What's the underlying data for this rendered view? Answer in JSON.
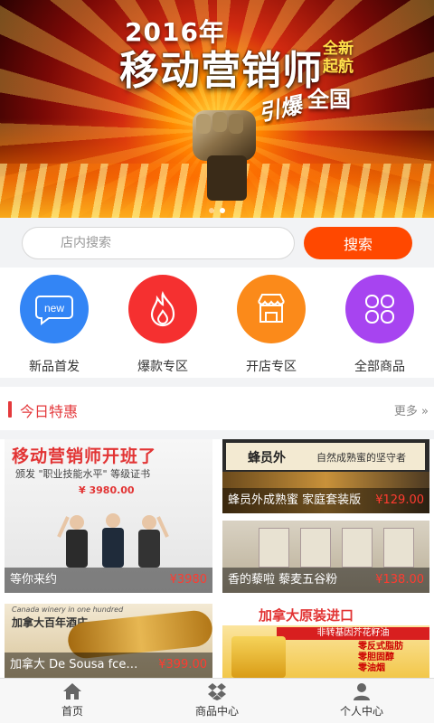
{
  "banner": {
    "year": "2016年",
    "title": "移动营销师",
    "side": "全新起航",
    "brush": "引爆",
    "sub": "全国",
    "dots": 2,
    "active_dot": 1
  },
  "search": {
    "placeholder": "店内搜索",
    "button": "搜索"
  },
  "categories": [
    {
      "label": "新品首发",
      "icon": "new-icon",
      "color": "#3385f5"
    },
    {
      "label": "爆款专区",
      "icon": "fire-icon",
      "color": "#f53030"
    },
    {
      "label": "开店专区",
      "icon": "shop-icon",
      "color": "#fb8a1a"
    },
    {
      "label": "全部商品",
      "icon": "grid-icon",
      "color": "#a744f0"
    }
  ],
  "today": {
    "title": "今日特惠",
    "more": "更多 »"
  },
  "products": [
    {
      "name": "等你来约",
      "price": "¥3980",
      "image_headline": "移动营销师开班了",
      "image_cert": "颁发 \"职业技能水平\" 等级证书",
      "image_amount": "¥ 3980.00"
    },
    {
      "name": "蜂员外成熟蜜 家庭套装版",
      "price": "¥129.00",
      "image_brand": "蜂员外",
      "image_slogan": "自然成熟蜜的坚守者"
    },
    {
      "name": "香的藜啦 藜麦五谷粉",
      "price": "¥138.00"
    },
    {
      "name": "加拿大 De Sousa fcewine…",
      "price": "¥399.00",
      "image_top": "Canada winery in one hundred",
      "image_main": "加拿大百年酒庄"
    },
    {
      "name": "",
      "price": "",
      "image_title": "加拿大原装进口",
      "image_strip": "非转基因芥花籽油",
      "image_list": [
        "零反式脂肪",
        "零胆固醇",
        "零油烟"
      ]
    }
  ],
  "tabbar": [
    {
      "label": "首页",
      "icon": "home-icon"
    },
    {
      "label": "商品中心",
      "icon": "dropbox-icon"
    },
    {
      "label": "个人中心",
      "icon": "user-icon"
    }
  ]
}
